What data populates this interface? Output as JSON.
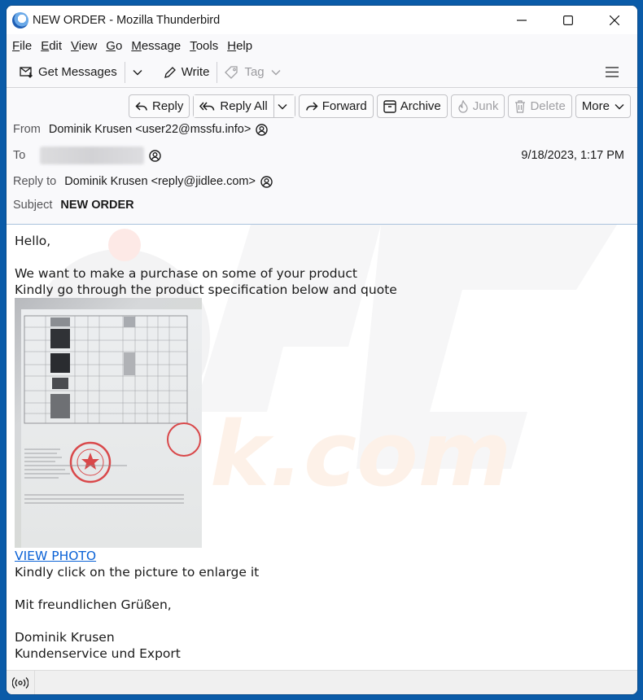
{
  "window": {
    "title": "NEW ORDER - Mozilla Thunderbird",
    "controls": [
      "minimize-icon",
      "maximize-icon",
      "close-icon"
    ]
  },
  "menubar": {
    "items": [
      {
        "label_u": "F",
        "label_rest": "ile"
      },
      {
        "label_u": "E",
        "label_rest": "dit"
      },
      {
        "label_u": "V",
        "label_rest": "iew"
      },
      {
        "label_u": "G",
        "label_rest": "o"
      },
      {
        "label_u": "M",
        "label_rest": "essage"
      },
      {
        "label_u": "T",
        "label_rest": "ools"
      },
      {
        "label_u": "H",
        "label_rest": "elp"
      }
    ]
  },
  "toolbar": {
    "get_messages": "Get Messages",
    "write": "Write",
    "tag": "Tag"
  },
  "actions": {
    "reply": "Reply",
    "reply_all": "Reply All",
    "forward": "Forward",
    "archive": "Archive",
    "junk": "Junk",
    "delete": "Delete",
    "more": "More"
  },
  "header": {
    "from_label": "From",
    "from_value": "Dominik Krusen <user22@mssfu.info>",
    "to_label": "To",
    "to_value_redacted": true,
    "date": "9/18/2023, 1:17 PM",
    "reply_to_label": "Reply to",
    "reply_to_value": "Dominik Krusen <reply@jidlee.com>",
    "subject_label": "Subject",
    "subject_value": "NEW ORDER"
  },
  "body": {
    "greeting": "Hello,",
    "line1": "We want to make a purchase on some of your product",
    "line2": "Kindly go through the product specification below and quote",
    "attachment_alt": "Scanned product specification document with red stamps",
    "link": "VIEW PHOTO",
    "line3": "Kindly click on the picture to enlarge it",
    "closing": "Mit freundlichen Grüßen,",
    "sig_name": "Dominik Krusen",
    "sig_title": "Kundenservice und Export"
  },
  "statusbar": {
    "icon": "online-status-icon"
  }
}
